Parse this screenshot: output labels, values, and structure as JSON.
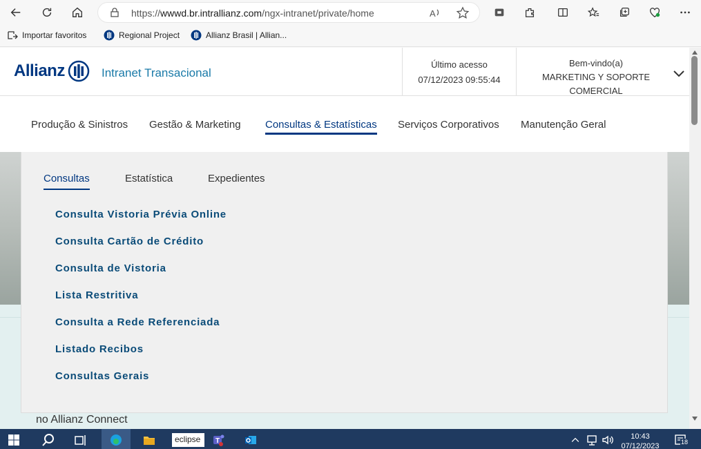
{
  "browser": {
    "url_prefix": "https://",
    "url_domain": "wwwd.br.intrallianz.com",
    "url_path": "/ngx-intranet/private/home"
  },
  "favorites": [
    {
      "label": "Importar favoritos"
    },
    {
      "label": "Regional Project"
    },
    {
      "label": "Allianz Brasil | Allian..."
    }
  ],
  "header": {
    "logo_text": "Allianz",
    "subtitle": "Intranet Transacional",
    "last_access_label": "Último acesso",
    "last_access_value": "07/12/2023 09:55:44",
    "welcome_label": "Bem-vindo(a)",
    "welcome_user_line1": "MARKETING Y SOPORTE",
    "welcome_user_line2": "COMERCIAL"
  },
  "nav": {
    "items": [
      {
        "label": "Produção & Sinistros"
      },
      {
        "label": "Gestão & Marketing"
      },
      {
        "label": "Consultas & Estatísticas"
      },
      {
        "label": "Serviços Corporativos"
      },
      {
        "label": "Manutenção Geral"
      }
    ]
  },
  "dropdown": {
    "tabs": [
      {
        "label": "Consultas"
      },
      {
        "label": "Estatística"
      },
      {
        "label": "Expedientes"
      }
    ],
    "links": [
      {
        "label": "Consulta Vistoria Prévia Online"
      },
      {
        "label": "Consulta Cartão de Crédito"
      },
      {
        "label": "Consulta de Vistoria"
      },
      {
        "label": "Lista Restritiva"
      },
      {
        "label": "Consulta a Rede Referenciada"
      },
      {
        "label": "Listado Recibos"
      },
      {
        "label": "Consultas Gerais"
      }
    ]
  },
  "page": {
    "connect_text": "no Allianz Connect"
  },
  "taskbar": {
    "eclipse_label": "eclipse",
    "time": "10:43",
    "date": "07/12/2023",
    "notifications": "18"
  },
  "colors": {
    "brand_blue": "#003781",
    "link_blue": "#0a4b78",
    "subtitle_blue": "#1a7aa8",
    "taskbar": "#1f3a60"
  }
}
